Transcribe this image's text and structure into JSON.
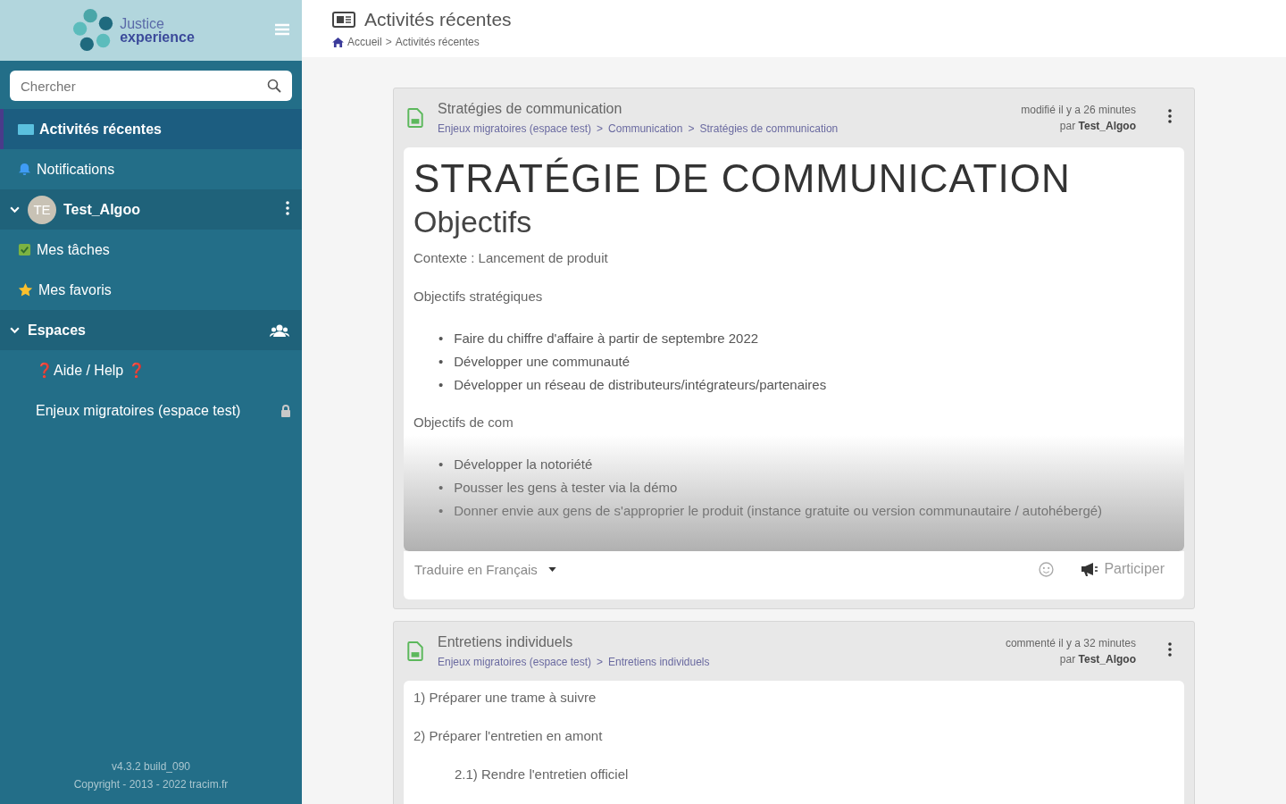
{
  "logo": {
    "line1": "Justice",
    "line2": "experience"
  },
  "search": {
    "placeholder": "Chercher"
  },
  "sidebar": {
    "items": [
      {
        "kind": "recent",
        "label": "Activités récentes",
        "selected": true
      },
      {
        "kind": "notifications",
        "label": "Notifications",
        "selected": false
      },
      {
        "kind": "user",
        "initials": "TE",
        "label": "Test_Algoo",
        "expanded": true,
        "children": [
          {
            "kind": "tasks",
            "label": "Mes tâches",
            "selected": false
          },
          {
            "kind": "favorites",
            "label": "Mes favoris",
            "selected": false
          }
        ]
      },
      {
        "kind": "section",
        "label": "Espaces",
        "expanded": true,
        "children": [
          {
            "kind": "space",
            "label": "❓Aide / Help ❓",
            "selected": false
          },
          {
            "kind": "space",
            "label": "Enjeux migratoires (espace test)",
            "selected": false,
            "locked": true
          }
        ]
      }
    ]
  },
  "sidebar_footer": {
    "version": "v4.3.2 build_090",
    "copyright": "Copyright - 2013 - 2022 tracim.fr"
  },
  "header": {
    "title": "Activités récentes",
    "separator": ">",
    "breadcrumb": [
      "Accueil",
      "Activités récentes"
    ]
  },
  "cards": [
    {
      "title": "Stratégies de communication",
      "separator": ">",
      "path": [
        "Enjeux migratoires (espace test)",
        "Communication",
        "Stratégies de communication"
      ],
      "activity": "modifié il y a 26 minutes",
      "by": "par",
      "author": "Test_Algoo",
      "faded": true,
      "content": [
        {
          "kind": "h1",
          "text": "STRATÉGIE DE COMMUNICATION"
        },
        {
          "kind": "h2",
          "text": "Objectifs"
        },
        {
          "kind": "p",
          "text": "Contexte : Lancement de produit"
        },
        {
          "kind": "p",
          "text": "Objectifs stratégiques"
        },
        {
          "kind": "list",
          "bullet": "•",
          "items": [
            "Faire du chiffre d'affaire à partir de septembre 2022",
            "Développer une communauté",
            "Développer un réseau de distributeurs/intégrateurs/partenaires"
          ]
        },
        {
          "kind": "p",
          "text": "Objectifs de com"
        },
        {
          "kind": "list",
          "bullet": "•",
          "items": [
            "Développer la notoriété",
            "Pousser les gens à tester via la démo",
            "Donner envie aux gens de s'approprier le produit (instance gratuite ou version communautaire / autohébergé)"
          ]
        }
      ],
      "footer": {
        "translate": "Traduire en Français",
        "participate": "Participer"
      }
    },
    {
      "title": "Entretiens individuels",
      "separator": ">",
      "path": [
        "Enjeux migratoires (espace test)",
        "Entretiens individuels"
      ],
      "activity": "commenté il y a 32 minutes",
      "by": "par",
      "author": "Test_Algoo",
      "content": [
        {
          "kind": "p",
          "text": "1) Préparer une trame à suivre"
        },
        {
          "kind": "p",
          "text": "2) Préparer l'entretien en amont"
        },
        {
          "kind": "sub",
          "text": "2.1) Rendre l'entretien officiel"
        }
      ]
    }
  ]
}
